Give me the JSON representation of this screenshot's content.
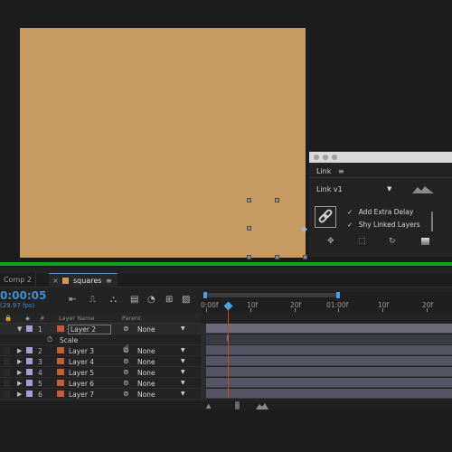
{
  "link_panel": {
    "tab_label": "Link",
    "menu_glyph": "≡",
    "version_label": "Link v1",
    "version_arrow": "▼",
    "options": [
      {
        "check": "✓",
        "label": "Add Extra Delay"
      },
      {
        "check": "✓",
        "label": "Shy Linked Layers"
      }
    ],
    "tool_icons": [
      "move-icon",
      "bounding-box-icon",
      "rotate-icon",
      "gradient-icon"
    ]
  },
  "tabs": {
    "comp2_label": "Comp 2",
    "squares_label": "squares",
    "close_glyph": "×",
    "menu_glyph": "≡"
  },
  "timeline": {
    "timecode": "0:00:05",
    "fps": "(29.97 fps)",
    "ruler_labels": [
      "0:00f",
      "10f",
      "20f",
      "01:00f",
      "10f",
      "20f"
    ],
    "columns": {
      "hash": "#",
      "layer_name": "Layer Name",
      "parent": "Parent"
    }
  },
  "layers": [
    {
      "num": "1",
      "name": "Layer 2",
      "parent": "None",
      "expanded": true
    },
    {
      "num": "2",
      "name": "Layer 3",
      "parent": "None"
    },
    {
      "num": "3",
      "name": "Layer 4",
      "parent": "None"
    },
    {
      "num": "4",
      "name": "Layer 5",
      "parent": "None"
    },
    {
      "num": "5",
      "name": "Layer 6",
      "parent": "None"
    },
    {
      "num": "6",
      "name": "Layer 7",
      "parent": "None"
    }
  ],
  "property": {
    "label": "Scale"
  },
  "colors": {
    "comp_bg": "#c59b61",
    "accent_blue": "#3c8fd6",
    "green_bar": "#0ba31a",
    "layer_label": "#a79fd1"
  }
}
